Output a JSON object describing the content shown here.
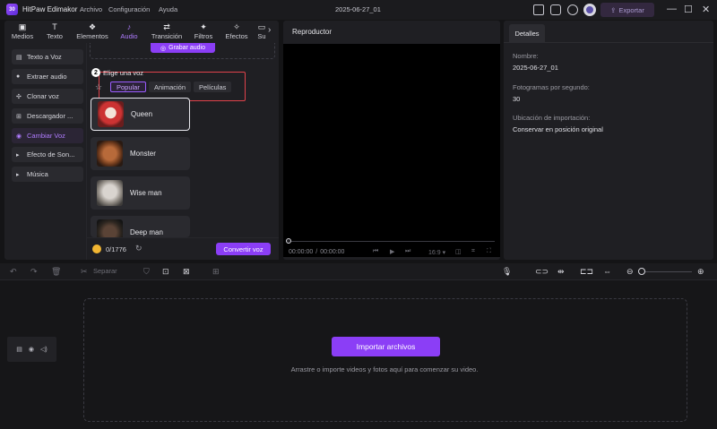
{
  "titlebar": {
    "app_name": "HitPaw Edimakor",
    "logo_text": "30",
    "menus": [
      "Archivo",
      "Configuración",
      "Ayuda"
    ],
    "document_title": "2025-06-27_01",
    "export_label": "Exportar"
  },
  "media_tabs": [
    {
      "label": "Medios",
      "icon": "film-icon",
      "glyph": "▣"
    },
    {
      "label": "Texto",
      "icon": "text-icon",
      "glyph": "T"
    },
    {
      "label": "Elementos",
      "icon": "elements-icon",
      "glyph": "❖"
    },
    {
      "label": "Audio",
      "icon": "music-icon",
      "glyph": "♪"
    },
    {
      "label": "Transición",
      "icon": "transition-icon",
      "glyph": "⇄"
    },
    {
      "label": "Filtros",
      "icon": "filter-icon",
      "glyph": "✦"
    },
    {
      "label": "Efectos",
      "icon": "effects-icon",
      "glyph": "✧"
    },
    {
      "label": "Su",
      "icon": "subtitle-icon",
      "glyph": "▭"
    }
  ],
  "active_tab": "Audio",
  "audio_sidebar": [
    {
      "label": "Texto a Voz",
      "glyph": "▤"
    },
    {
      "label": "Extraer audio",
      "glyph": "🎙"
    },
    {
      "label": "Clonar voz",
      "glyph": "✣"
    },
    {
      "label": "Descargador ...",
      "glyph": "⊞"
    },
    {
      "label": "Cambiar Voz",
      "glyph": "◉"
    },
    {
      "label": "Efecto de Son...",
      "glyph": "▸"
    },
    {
      "label": "Música",
      "glyph": "▸"
    }
  ],
  "voice_changer": {
    "record_label": "Grabar audio",
    "step_number": "2",
    "heading": "Elige una voz",
    "categories": [
      "Popular",
      "Animación",
      "Películas"
    ],
    "active_category": "Popular",
    "voices": [
      "Queen",
      "Monster",
      "Wise man",
      "Deep man"
    ],
    "selected_voice": "Queen",
    "credits": "0/1776",
    "convert_label": "Convertir voz"
  },
  "player": {
    "title": "Reproductor",
    "time_current": "00:00:00",
    "time_separator": "/",
    "time_total": "00:00:00",
    "aspect": "16:9"
  },
  "details": {
    "tab_label": "Detalles",
    "name_label": "Nombre:",
    "name_value": "2025-06-27_01",
    "fps_label": "Fotogramas por segundo:",
    "fps_value": "30",
    "import_location_label": "Ubicación de importación:",
    "import_location_value": "Conservar en posición original"
  },
  "timeline": {
    "split_label": "Separar",
    "import_button": "Importar archivos",
    "drop_hint": "Arrastre o importe videos y fotos aquí para comenzar su video."
  },
  "colors": {
    "accent": "#8b3ef6",
    "accent_text": "#b07cff",
    "highlight_box": "#e0434b",
    "panel_bg": "#1f1f23"
  }
}
